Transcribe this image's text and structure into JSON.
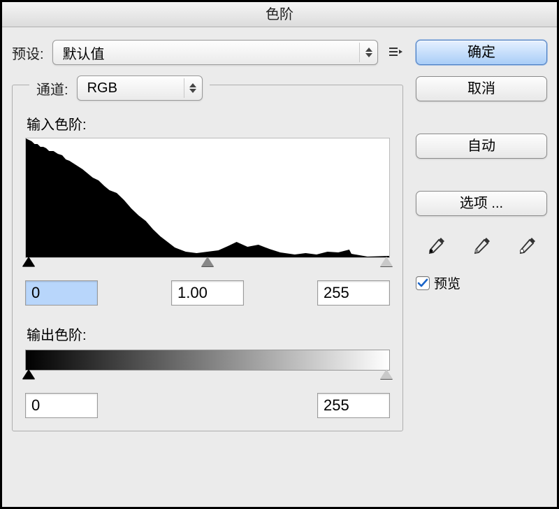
{
  "title": "色阶",
  "preset": {
    "label": "预设:",
    "value": "默认值"
  },
  "channel": {
    "label": "通道:",
    "value": "RGB"
  },
  "input_levels": {
    "label": "输入色阶:",
    "black": "0",
    "gamma": "1.00",
    "white": "255"
  },
  "output_levels": {
    "label": "输出色阶:",
    "black": "0",
    "white": "255"
  },
  "buttons": {
    "ok": "确定",
    "cancel": "取消",
    "auto": "自动",
    "options": "选项 ..."
  },
  "preview": {
    "label": "预览",
    "checked": true
  },
  "icons": {
    "preset_menu": "preset-menu-icon",
    "eyedropper_black": "eyedropper-black-icon",
    "eyedropper_gray": "eyedropper-gray-icon",
    "eyedropper_white": "eyedropper-white-icon"
  }
}
